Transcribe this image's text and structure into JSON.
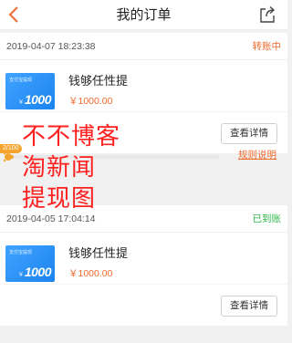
{
  "header": {
    "title": "我的订单",
    "back_icon": "chevron-left-icon",
    "share_icon": "share-icon"
  },
  "orders": [
    {
      "time": "2019-04-07 18:23:38",
      "status": "转账中",
      "status_color": "#f06a2d",
      "thumb_caption": "支付宝提现",
      "thumb_yen": "¥",
      "thumb_amount": "1000",
      "product_name": "钱够任性提",
      "price": "￥1000.00",
      "detail_button": "查看详情"
    },
    {
      "time": "2019-04-05 17:04:14",
      "status": "已到账",
      "status_color": "#2eb84a",
      "thumb_caption": "支付宝提现",
      "thumb_yen": "¥",
      "thumb_amount": "1000",
      "product_name": "钱够任性提",
      "price": "￥1000.00",
      "detail_button": "查看详情"
    }
  ],
  "progress": {
    "label": "2/100",
    "fraction": 0.02,
    "color": "#f5a52f"
  },
  "rules_link": "规则说明",
  "watermark": {
    "line1": "不不博客",
    "line2": "淘新闻",
    "line3": "提现图"
  },
  "colors": {
    "accent": "#f06a2d",
    "success": "#2eb84a",
    "thumb_blue": "#1c84ef"
  }
}
